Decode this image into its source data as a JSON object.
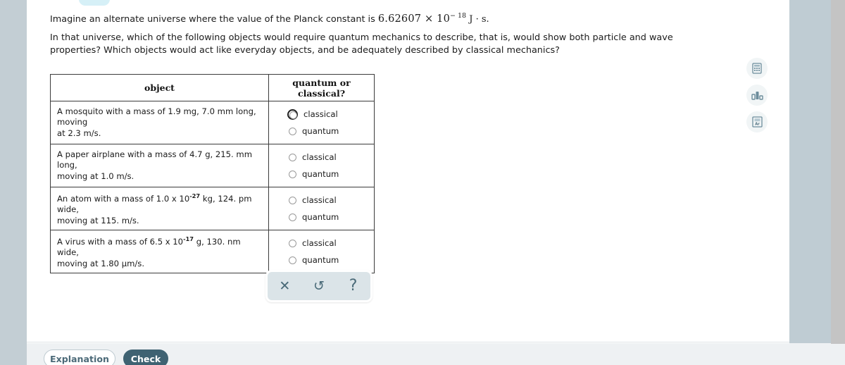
{
  "prompt": {
    "line1_before": "Imagine an alternate universe where the value of the Planck constant is ",
    "line1_value": "6.62607",
    "line1_times": " × ",
    "line1_base": "10",
    "line1_exponent": "− 18",
    "line1_units": " J · s.",
    "line2": "In that universe, which of the following objects would require quantum mechanics to describe, that is, would show both particle and wave properties? Which objects would act like everyday objects, and be adequately described by classical mechanics?"
  },
  "table": {
    "headers": {
      "object": "object",
      "answer": "quantum or classical?"
    },
    "rows": [
      {
        "object_line1": "A mosquito with a mass of 1.9 mg, 7.0 mm long, moving",
        "object_line2": "at 2.3 m/s.",
        "object_sup": "",
        "options": [
          {
            "label": "classical",
            "focused": true,
            "selected": false
          },
          {
            "label": "quantum",
            "focused": false,
            "selected": false
          }
        ]
      },
      {
        "object_line1": "A paper airplane with a mass of 4.7 g, 215. mm long,",
        "object_line2": "moving at 1.0 m/s.",
        "object_sup": "",
        "options": [
          {
            "label": "classical",
            "focused": false,
            "selected": false
          },
          {
            "label": "quantum",
            "focused": false,
            "selected": false
          }
        ]
      },
      {
        "object_pre": "An atom with a mass of 1.0 x 10",
        "object_sup": "-27",
        "object_post": " kg, 124. pm wide,",
        "object_line2": "moving at 115. m/s.",
        "options": [
          {
            "label": "classical",
            "focused": false,
            "selected": false
          },
          {
            "label": "quantum",
            "focused": false,
            "selected": false
          }
        ]
      },
      {
        "object_pre": "A virus with a mass of 6.5 x 10",
        "object_sup": "-17",
        "object_post": " g, 130. nm wide,",
        "object_line2": "moving at 1.80 µm/s.",
        "options": [
          {
            "label": "classical",
            "focused": false,
            "selected": false
          },
          {
            "label": "quantum",
            "focused": false,
            "selected": false
          }
        ]
      }
    ]
  },
  "mini_toolbar": {
    "clear": {
      "icon": "close-icon",
      "glyph": "✕"
    },
    "undo": {
      "icon": "undo-icon",
      "glyph": "↺"
    },
    "help": {
      "icon": "question-icon",
      "glyph": "?"
    }
  },
  "tools": [
    {
      "name": "calculator-tool",
      "icon": "calculator-icon"
    },
    {
      "name": "chart-tool",
      "icon": "bar-chart-icon"
    },
    {
      "name": "periodic-table-tool",
      "icon": "periodic-table-icon",
      "symbol": "Ar"
    }
  ],
  "footer": {
    "explanation_label": "Explanation",
    "check_label": "Check"
  },
  "colors": {
    "rail": "#c3ced4",
    "right_rail": "#bfccd3",
    "footer_bg": "#eef1f3",
    "accent": "#3f6272",
    "toolbar_bg": "#dbe4e8",
    "tab": "#d6f0f7",
    "text": "#1b1b1b"
  }
}
